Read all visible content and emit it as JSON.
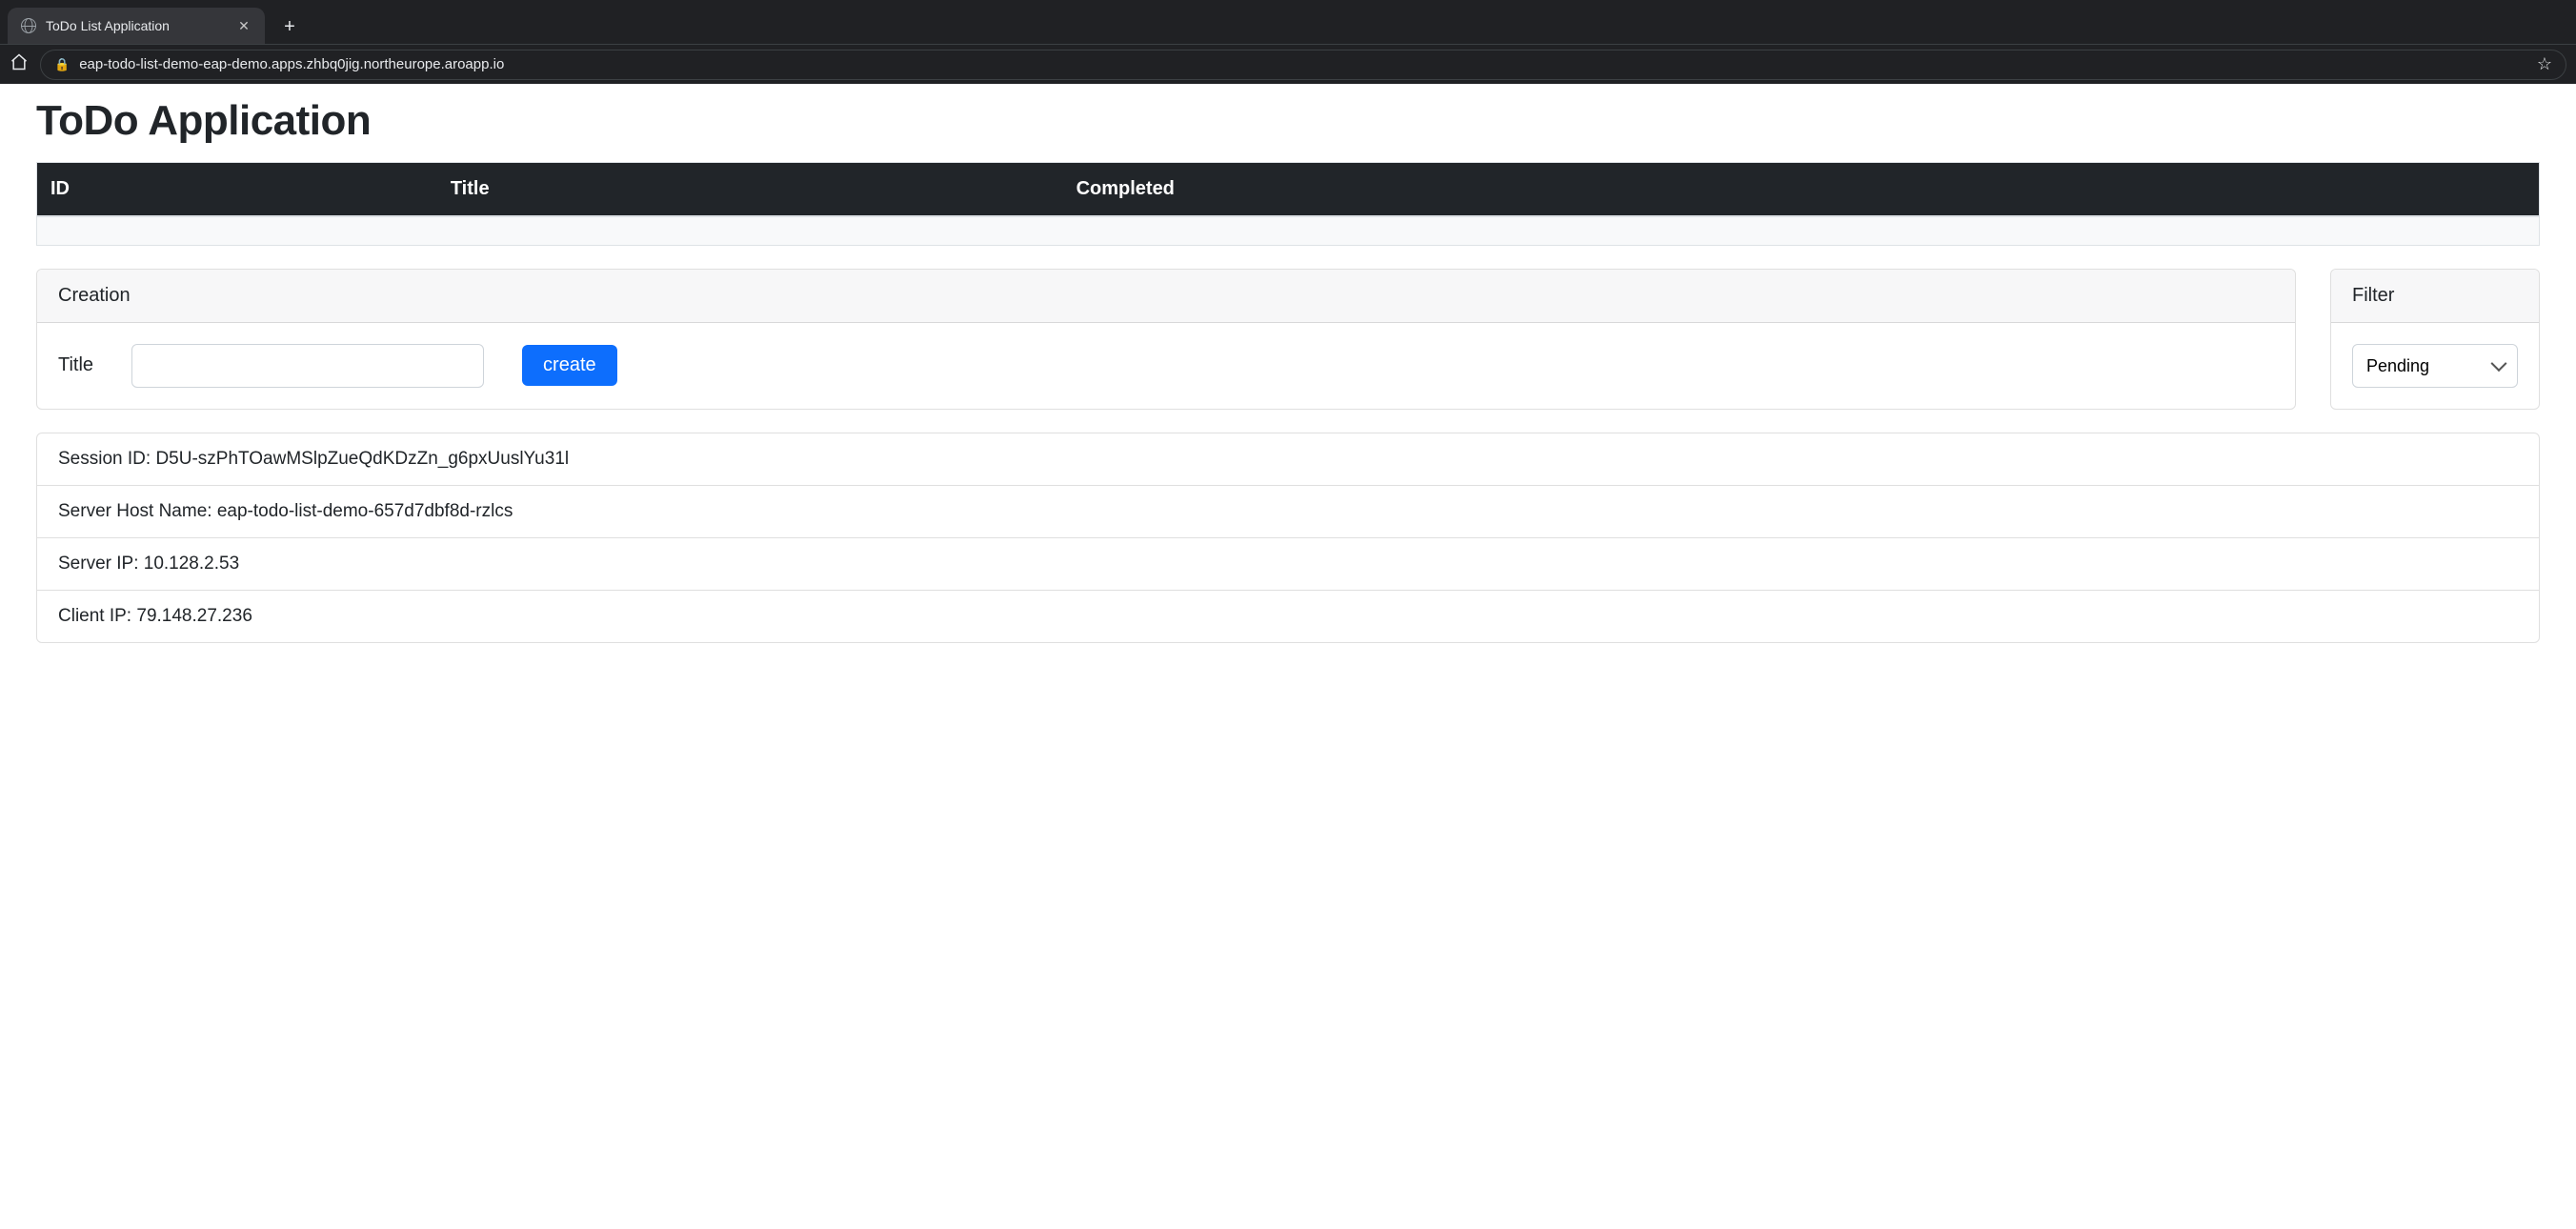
{
  "browser": {
    "tab_title": "ToDo List Application",
    "url": "eap-todo-list-demo-eap-demo.apps.zhbq0jig.northeurope.aroapp.io"
  },
  "app": {
    "title": "ToDo Application"
  },
  "table": {
    "headers": {
      "id": "ID",
      "title": "Title",
      "completed": "Completed"
    }
  },
  "creation": {
    "panel_title": "Creation",
    "title_label": "Title",
    "title_value": "",
    "create_button": "create"
  },
  "filter": {
    "panel_title": "Filter",
    "selected": "Pending"
  },
  "info": {
    "session_id_label": "Session ID:",
    "session_id_value": "D5U-szPhTOawMSlpZueQdKDzZn_g6pxUuslYu31l",
    "server_host_label": "Server Host Name:",
    "server_host_value": "eap-todo-list-demo-657d7dbf8d-rzlcs",
    "server_ip_label": "Server IP:",
    "server_ip_value": "10.128.2.53",
    "client_ip_label": "Client IP:",
    "client_ip_value": "79.148.27.236"
  }
}
